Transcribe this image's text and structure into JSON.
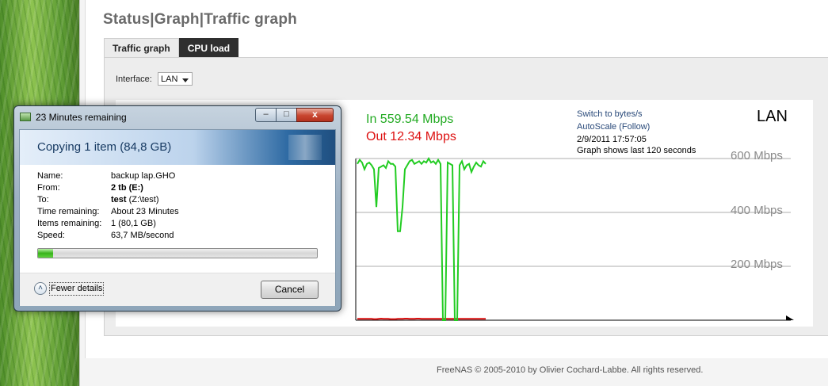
{
  "page": {
    "title": "Status|Graph|Traffic graph",
    "tabs": [
      {
        "label": "Traffic graph",
        "active": true
      },
      {
        "label": "CPU load",
        "active": false
      }
    ],
    "interface": {
      "label": "Interface:",
      "value": "LAN"
    },
    "footer": "FreeNAS © 2005-2010 by Olivier Cochard-Labbe. All rights reserved."
  },
  "graph": {
    "in_label": "In 559.54 Mbps",
    "out_label": "Out 12.34 Mbps",
    "switch_link": "Switch to bytes/s",
    "autoscale_link": "AutoScale (Follow)",
    "datetime": "2/9/2011 17:57:05",
    "window_note": "Graph shows last 120 seconds",
    "interface_name": "LAN",
    "gridlines": [
      "600 Mbps",
      "400 Mbps",
      "200 Mbps"
    ],
    "colors": {
      "in": "#22cc22",
      "out": "#dd1111",
      "grid": "#d6d6d6"
    }
  },
  "chart_data": {
    "type": "line",
    "title": "LAN",
    "ylabel": "Mbps",
    "ylim": [
      0,
      600
    ],
    "series": [
      {
        "name": "In",
        "color": "#22cc22",
        "values": [
          580,
          595,
          585,
          560,
          580,
          585,
          575,
          560,
          420,
          565,
          570,
          575,
          565,
          590,
          580,
          580,
          570,
          330,
          330,
          420,
          560,
          575,
          590,
          595,
          580,
          585,
          590,
          580,
          590,
          585,
          600,
          585,
          590,
          580,
          595,
          580,
          0,
          0,
          585,
          580,
          575,
          0,
          0,
          575,
          590,
          560,
          575,
          580,
          550,
          570,
          585,
          575,
          570,
          590,
          580
        ]
      },
      {
        "name": "Out",
        "color": "#dd1111",
        "values": [
          5,
          5,
          5,
          5,
          5,
          5,
          5,
          4,
          4,
          5,
          6,
          5,
          5,
          5,
          4,
          4,
          4,
          5,
          5,
          5,
          6,
          6,
          5,
          5,
          5,
          6,
          6,
          5,
          5,
          5,
          5,
          5,
          5,
          5,
          5,
          5,
          5,
          5,
          5,
          5,
          5,
          5,
          5,
          5,
          5,
          5,
          5,
          5,
          5,
          5,
          5,
          5,
          5,
          5,
          5
        ]
      }
    ]
  },
  "dialog": {
    "title": "23 Minutes remaining",
    "header": "Copying 1 item (84,8 GB)",
    "rows": [
      {
        "key": "Name:",
        "value": "backup lap.GHO",
        "bold": "",
        "rest": ""
      },
      {
        "key": "From:",
        "value": "",
        "bold": "2 tb (E:)",
        "rest": ""
      },
      {
        "key": "To:",
        "value": "",
        "bold": "test",
        "rest": " (Z:\\test)"
      },
      {
        "key": "Time remaining:",
        "value": "About 23 Minutes",
        "bold": "",
        "rest": ""
      },
      {
        "key": "Items remaining:",
        "value": "1 (80,1 GB)",
        "bold": "",
        "rest": ""
      },
      {
        "key": "Speed:",
        "value": "63,7 MB/second",
        "bold": "",
        "rest": ""
      }
    ],
    "progress_fraction": 0.055,
    "fewer_details": "Fewer details",
    "cancel": "Cancel",
    "min_glyph": "–",
    "max_glyph": "□",
    "close_glyph": "x",
    "fewer_glyph": "˄"
  }
}
